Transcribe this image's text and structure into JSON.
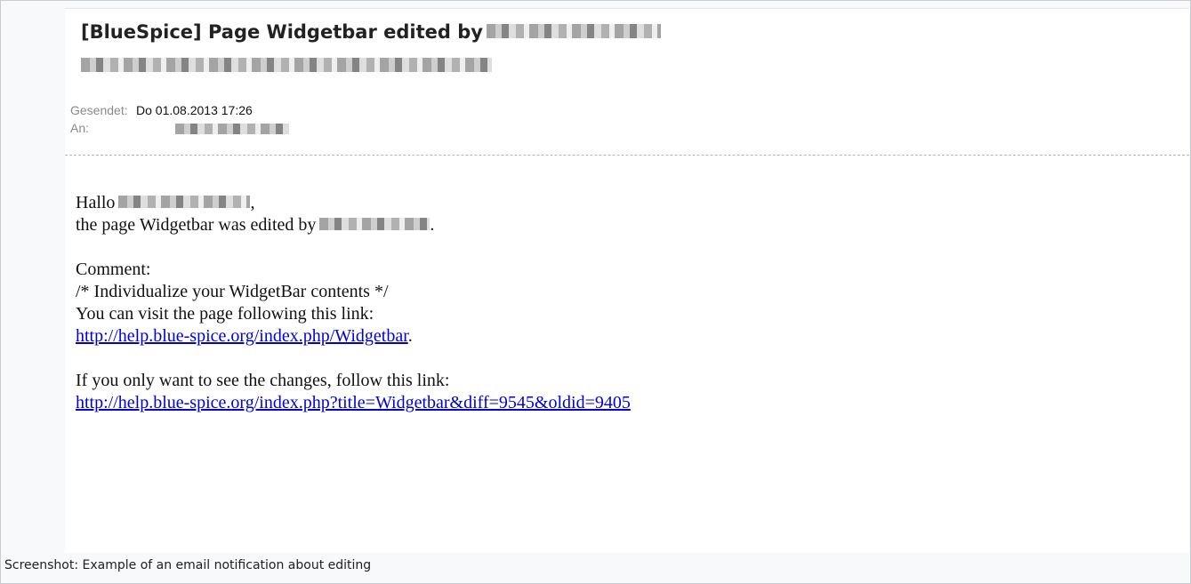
{
  "email": {
    "subject": "[BlueSpice] Page Widgetbar edited by",
    "sent_label": "Gesendet:",
    "sent_value": "Do 01.08.2013 17:26",
    "to_label": "An:",
    "body": {
      "greeting": "Hallo",
      "greeting_end": ",",
      "edited_line": "the page Widgetbar was edited by",
      "edited_line_end": ".",
      "comment_label": "Comment:",
      "comment_text": "/* Individualize your WidgetBar contents */",
      "visit_text": "You can visit the page following this link:",
      "page_link": "http://help.blue-spice.org/index.php/Widgetbar",
      "page_link_end": ".",
      "changes_text": "If you only want to see the changes, follow this link:",
      "diff_link": "http://help.blue-spice.org/index.php?title=Widgetbar&diff=9545&oldid=9405"
    }
  },
  "caption": "Screenshot: Example of an email notification about editing"
}
